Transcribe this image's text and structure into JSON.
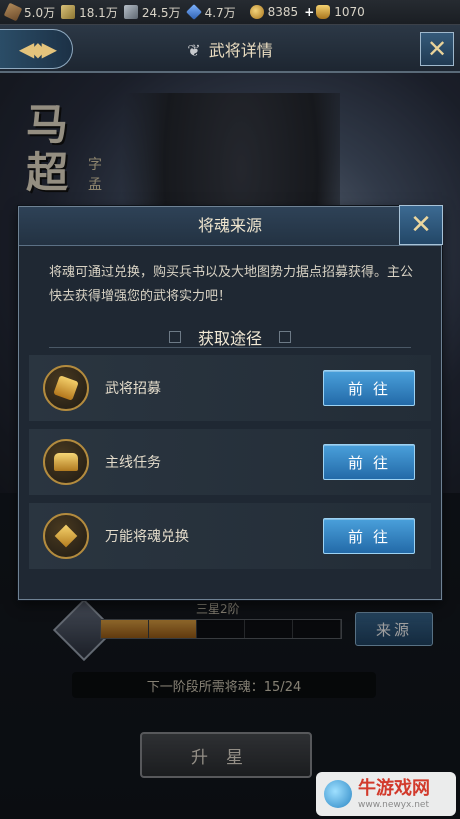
{
  "resources": [
    {
      "icon": "wood-icon",
      "cls": "wood",
      "value": "5.0万"
    },
    {
      "icon": "grain-icon",
      "cls": "grain",
      "value": "18.1万"
    },
    {
      "icon": "iron-icon",
      "cls": "iron",
      "value": "24.5万"
    },
    {
      "icon": "crystal-icon",
      "cls": "crystal",
      "value": "4.7万"
    },
    {
      "icon": "coin-icon",
      "cls": "coin",
      "value": "8385"
    },
    {
      "icon": "ingot-icon",
      "cls": "ingot",
      "value": "1070"
    }
  ],
  "header": {
    "title": "武将详情"
  },
  "hero": {
    "name": "马超",
    "courtesy": "字孟"
  },
  "dialog": {
    "title": "将魂来源",
    "description": "将魂可通过兑换，购买兵书以及大地图势力据点招募获得。主公快去获得增强您的武将实力吧！",
    "section_title": "获取途径",
    "rows": [
      {
        "icon": "recruit-scroll-icon",
        "glyph": "scroll",
        "label": "武将招募",
        "button": "前往"
      },
      {
        "icon": "treasure-chest-icon",
        "glyph": "chest",
        "label": "主线任务",
        "button": "前往"
      },
      {
        "icon": "puzzle-piece-icon",
        "glyph": "puzzle",
        "label": "万能将魂兑换",
        "button": "前往"
      }
    ]
  },
  "lower": {
    "star_level": "三星2阶",
    "progress_filled": 2,
    "progress_total": 5,
    "source_button": "来源",
    "next_stage": "下一阶段所需将魂：15/24",
    "upstar_button": "升星"
  },
  "watermark": {
    "title": "牛游戏网",
    "url": "www.newyx.net"
  }
}
